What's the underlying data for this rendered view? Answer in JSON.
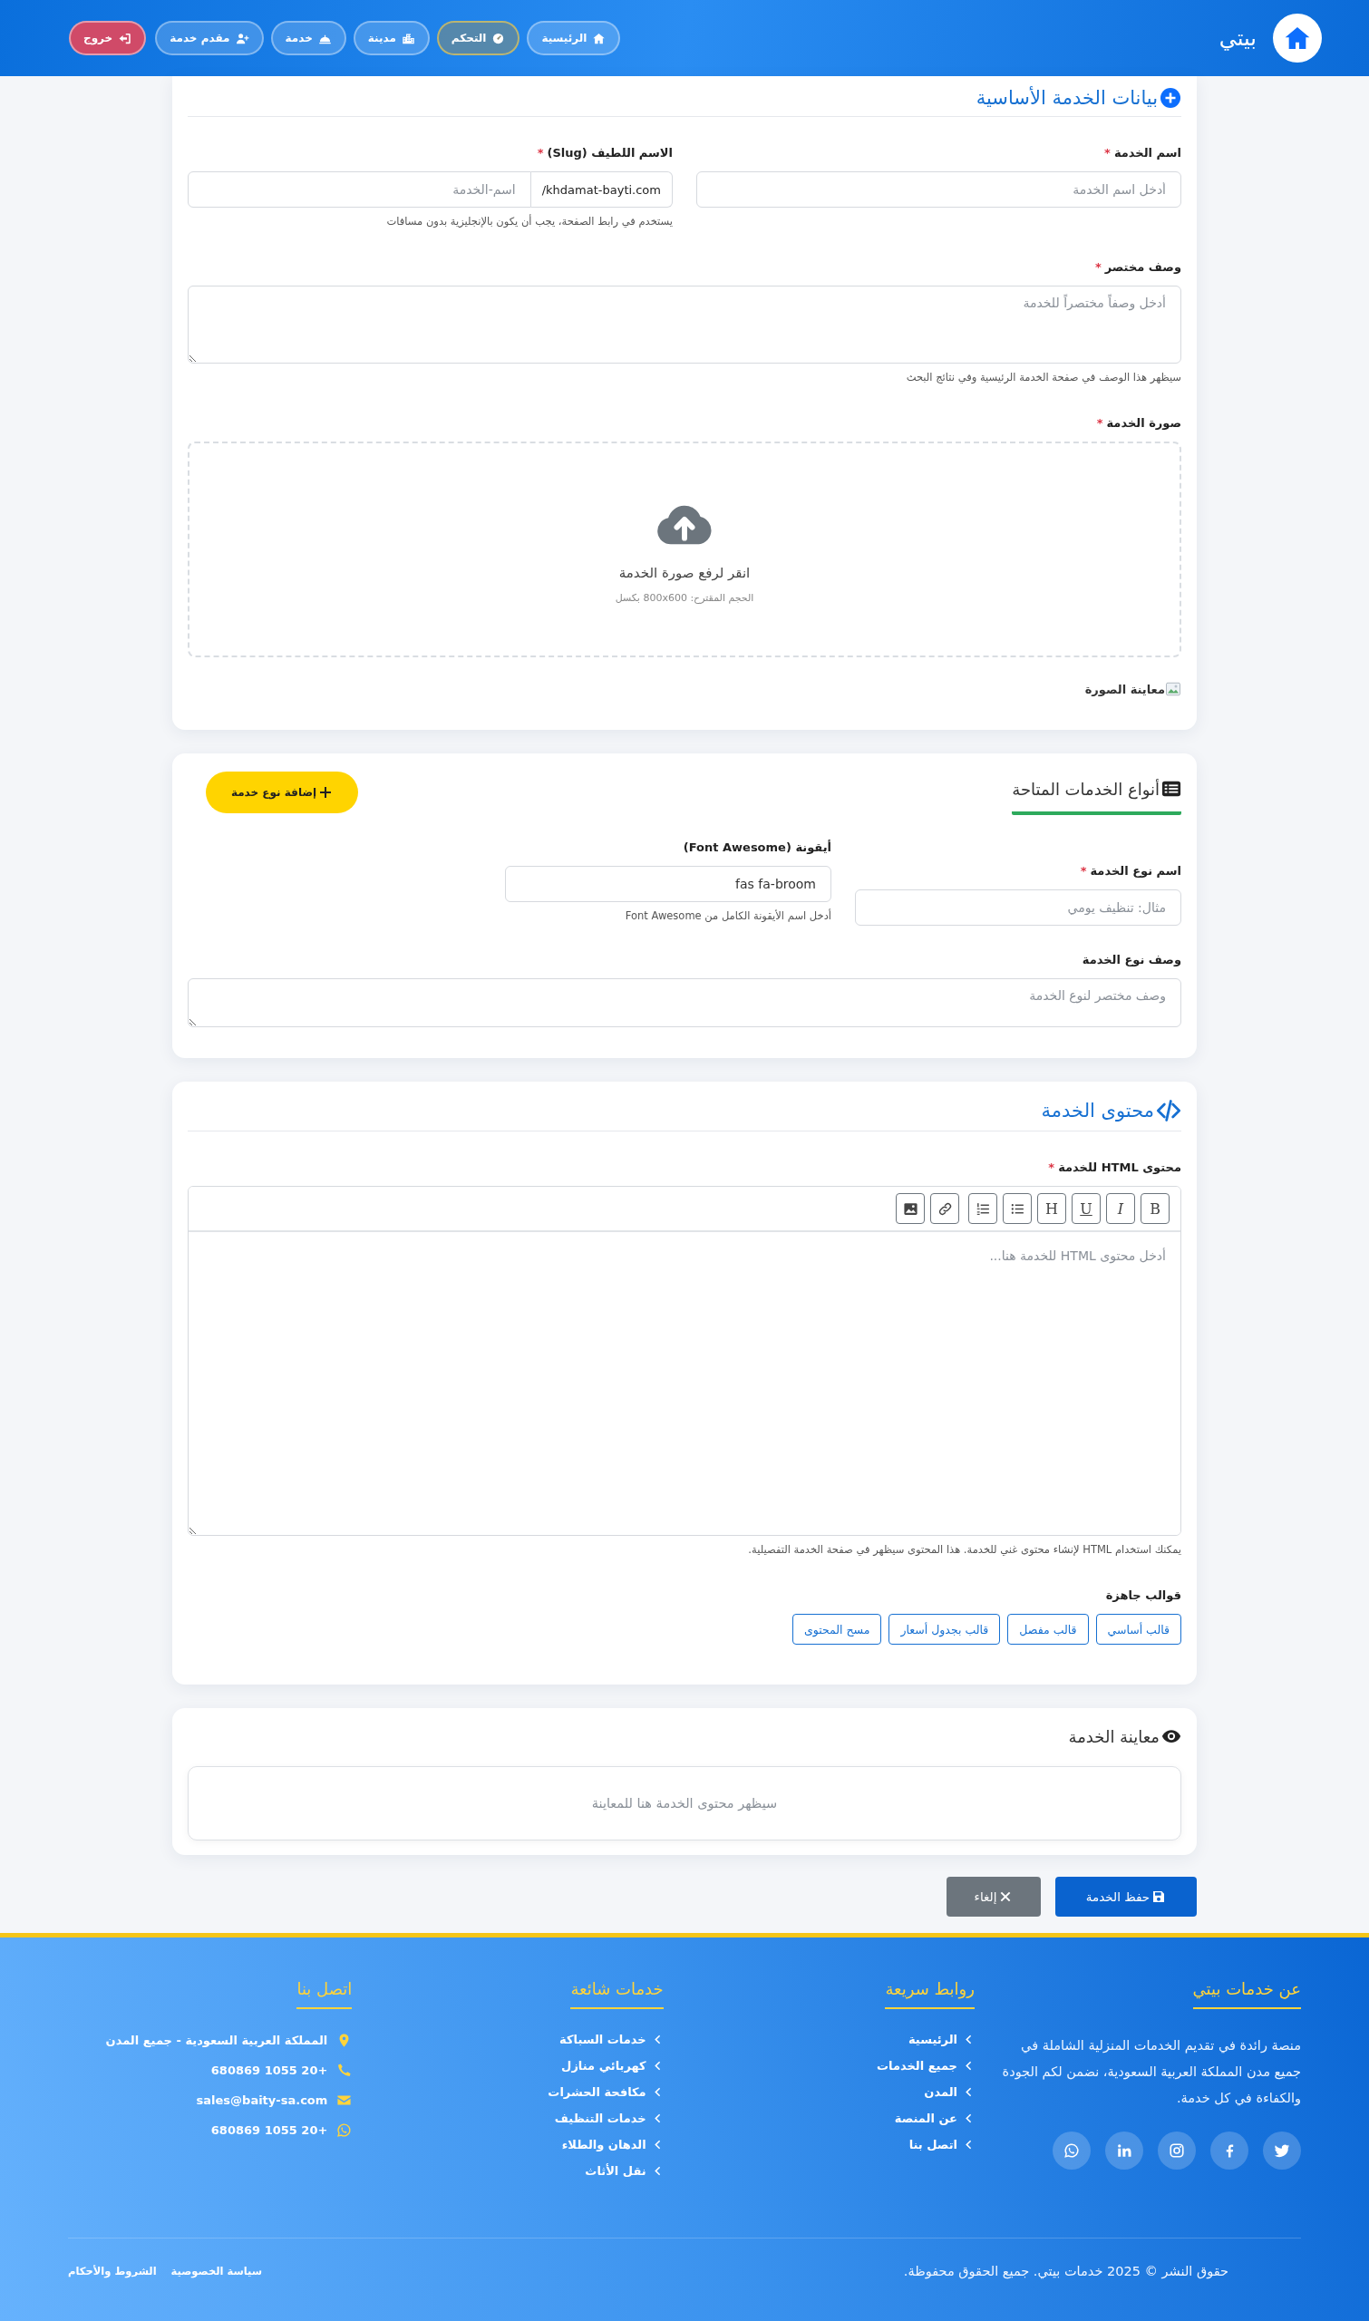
{
  "header": {
    "brand": "بيتي",
    "nav": [
      {
        "label": "الرئيسية",
        "selected": false
      },
      {
        "label": "التحكم",
        "selected": true
      },
      {
        "label": "مدينة",
        "selected": false
      },
      {
        "label": "خدمة",
        "selected": false
      },
      {
        "label": "مقدم خدمة",
        "selected": false
      }
    ],
    "logout": "خروج"
  },
  "basic": {
    "title": "بيانات الخدمة الأساسية",
    "name": {
      "label": "اسم الخدمة",
      "required_mark": "*",
      "placeholder": "أدخل اسم الخدمة"
    },
    "slug": {
      "label": "الاسم اللطيف (Slug)",
      "required_mark": "*",
      "prefix": "/khdamat-bayti.com",
      "placeholder": "اسم-الخدمة",
      "help": "يستخدم في رابط الصفحة، يجب أن يكون بالإنجليزية بدون مسافات"
    },
    "description": {
      "label": "وصف مختصر",
      "required_mark": "*",
      "placeholder": "أدخل وصفاً مختصراً للخدمة",
      "help": "سيظهر هذا الوصف في صفحة الخدمة الرئيسية وفي نتائج البحث"
    },
    "image": {
      "label": "صورة الخدمة",
      "required_mark": "*",
      "upload_text": "انقر لرفع صورة الخدمة",
      "upload_hint": "الحجم المقترح: 800x600 بكسل",
      "preview_alt": "معاينة الصورة"
    }
  },
  "types": {
    "title": "أنواع الخدمات المتاحة",
    "add_button": "إضافة نوع خدمة",
    "type_name": {
      "label": "اسم نوع الخدمة",
      "required_mark": "*",
      "placeholder": "مثال: تنظيف يومي"
    },
    "icon": {
      "label": "أيقونة (Font Awesome)",
      "value": "fas fa-broom",
      "help": "أدخل اسم الأيقونة الكامل من Font Awesome"
    },
    "description": {
      "label": "وصف نوع الخدمة",
      "placeholder": "وصف مختصر لنوع الخدمة"
    }
  },
  "content": {
    "title": "محتوى الخدمة",
    "label": "محتوى HTML للخدمة",
    "required_mark": "*",
    "toolbar": [
      {
        "kind": "bold",
        "label": "B"
      },
      {
        "kind": "italic",
        "label": "I"
      },
      {
        "kind": "underline",
        "label": "U"
      },
      {
        "kind": "heading",
        "label": "H"
      },
      {
        "kind": "list"
      },
      {
        "kind": "ordered_list"
      },
      {
        "kind": "link"
      },
      {
        "kind": "image"
      }
    ],
    "placeholder": "أدخل محتوى HTML للخدمة هنا...",
    "help": "يمكنك استخدام HTML لإنشاء محتوى غني للخدمة. هذا المحتوى سيظهر في صفحة الخدمة التفصيلية.",
    "templates_label": "قوالب جاهزة",
    "templates": [
      "قالب أساسي",
      "قالب مفصل",
      "قالب بجدول أسعار",
      "مسح المحتوى"
    ]
  },
  "preview": {
    "title": "معاينة الخدمة",
    "placeholder": "سيظهر محتوى الخدمة هنا للمعاينة"
  },
  "actions": {
    "save": "حفظ الخدمة",
    "cancel": "إلغاء"
  },
  "footer": {
    "about": {
      "title": "عن خدمات بيتي",
      "text": "منصة رائدة في تقديم الخدمات المنزلية الشاملة في جميع مدن المملكة العربية السعودية، نضمن لكم الجودة والكفاءة في كل خدمة."
    },
    "quick_links": {
      "title": "روابط سريعة",
      "items": [
        "الرئيسية",
        "جميع الخدمات",
        "المدن",
        "عن المنصة",
        "اتصل بنا"
      ]
    },
    "services": {
      "title": "خدمات شائعة",
      "items": [
        "خدمات السباكة",
        "كهربائي منازل",
        "مكافحة الحشرات",
        "خدمات التنظيف",
        "الدهان والطلاء",
        "نقل الأثاث"
      ]
    },
    "contact": {
      "title": "اتصل بنا",
      "items": [
        {
          "kind": "location",
          "text": "المملكة العربية السعودية - جميع المدن"
        },
        {
          "kind": "phone",
          "text": "+20 1055 680869"
        },
        {
          "kind": "email",
          "text": "sales@baity-sa.com"
        },
        {
          "kind": "whatsapp",
          "text": "+20 1055 680869"
        }
      ]
    },
    "copyright": "حقوق النشر © 2025 خدمات بيتي. جميع الحقوق محفوظة.",
    "bottom_links": [
      "سياسة الخصوصية",
      "الشروط والأحكام"
    ]
  }
}
